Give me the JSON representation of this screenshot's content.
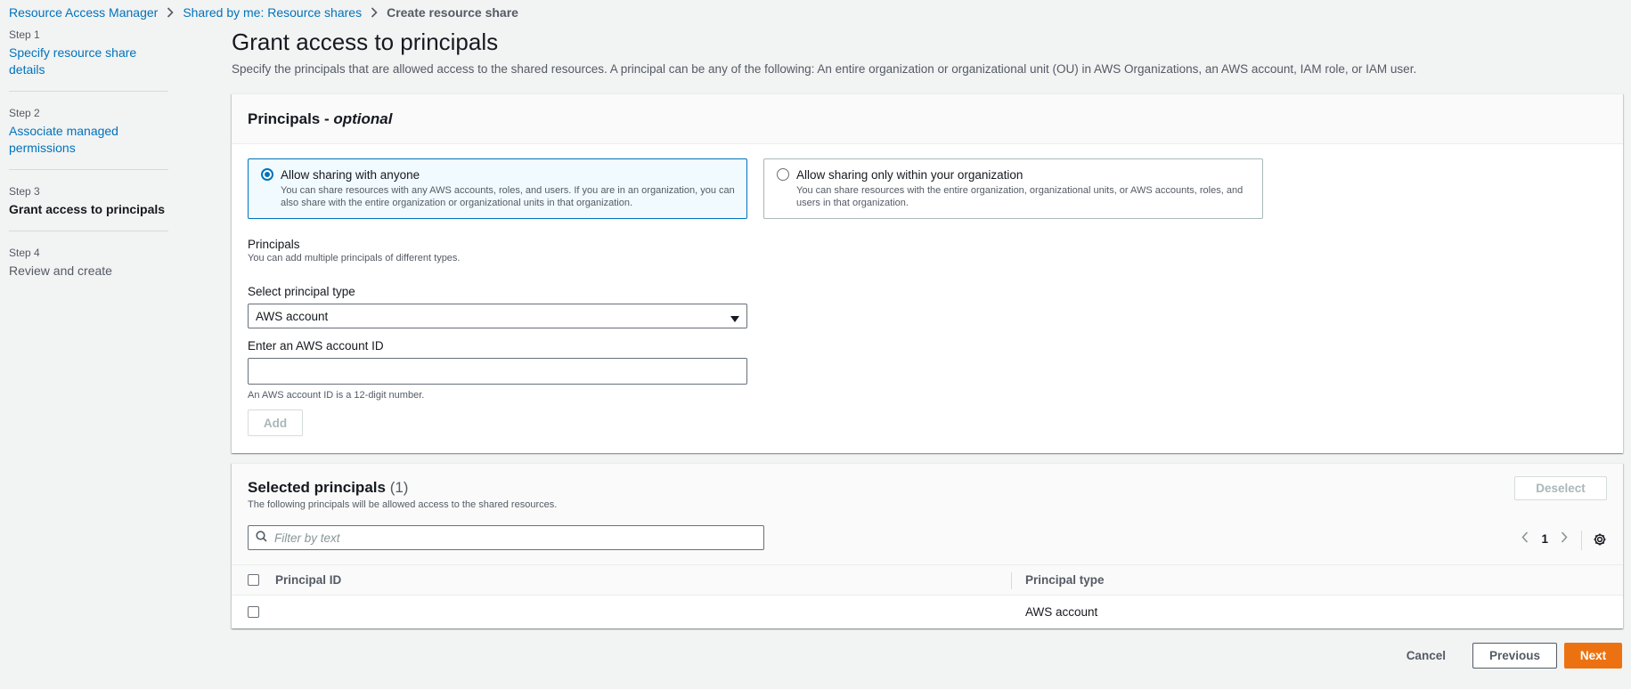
{
  "breadcrumb": {
    "items": [
      "Resource Access Manager",
      "Shared by me: Resource shares"
    ],
    "current": "Create resource share"
  },
  "steps": [
    {
      "num": "Step 1",
      "label": "Specify resource share details",
      "state": "link"
    },
    {
      "num": "Step 2",
      "label": "Associate managed permissions",
      "state": "link"
    },
    {
      "num": "Step 3",
      "label": "Grant access to principals",
      "state": "active"
    },
    {
      "num": "Step 4",
      "label": "Review and create",
      "state": "disabled"
    }
  ],
  "page": {
    "title": "Grant access to principals",
    "description": "Specify the principals that are allowed access to the shared resources. A principal can be any of the following: An entire organization or organizational unit (OU) in AWS Organizations, an AWS account, IAM role, or IAM user."
  },
  "principals_card": {
    "title_main": "Principals - ",
    "title_optional": "optional",
    "tile_anyone": {
      "title": "Allow sharing with anyone",
      "desc": "You can share resources with any AWS accounts, roles, and users. If you are in an organization, you can also share with the entire organization or organizational units in that organization.",
      "selected": true
    },
    "tile_org": {
      "title": "Allow sharing only within your organization",
      "desc": "You can share resources with the entire organization, organizational units, or AWS accounts, roles, and users in that organization.",
      "selected": false
    },
    "principals_label": "Principals",
    "principals_hint": "You can add multiple principals of different types.",
    "select_label": "Select principal type",
    "select_value": "AWS account",
    "account_label": "Enter an AWS account ID",
    "account_value": "",
    "account_constraint": "An AWS account ID is a 12-digit number.",
    "add_label": "Add"
  },
  "selected_card": {
    "title": "Selected principals",
    "count": "(1)",
    "desc": "The following principals will be allowed access to the shared resources.",
    "deselect_label": "Deselect",
    "filter_placeholder": "Filter by text",
    "page_number": "1",
    "columns": [
      "Principal ID",
      "Principal type"
    ],
    "rows": [
      {
        "principal_id": "",
        "principal_type": "AWS account"
      }
    ]
  },
  "footer": {
    "cancel": "Cancel",
    "previous": "Previous",
    "next": "Next"
  },
  "colors": {
    "link": "#0073bb",
    "primary_button": "#ec7211",
    "selected_tile_bg": "#f1faff"
  }
}
